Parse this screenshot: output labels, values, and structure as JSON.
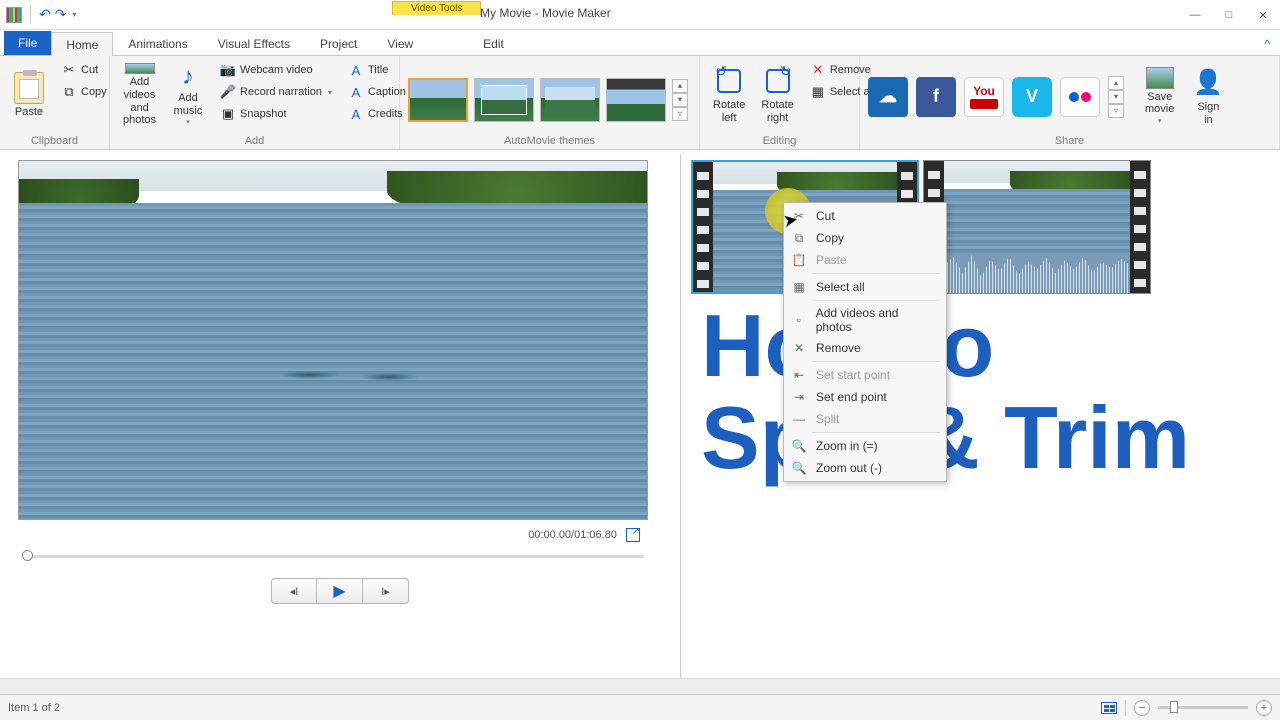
{
  "qat": {
    "undo": "↶",
    "redo": "↷"
  },
  "video_tools_label": "Video Tools",
  "window_title": "My Movie - Movie Maker",
  "tabs": {
    "file": "File",
    "home": "Home",
    "animations": "Animations",
    "visual_effects": "Visual Effects",
    "project": "Project",
    "view": "View",
    "edit": "Edit"
  },
  "ribbon": {
    "clipboard": {
      "label": "Clipboard",
      "paste": "Paste",
      "cut": "Cut",
      "copy": "Copy"
    },
    "add": {
      "label": "Add",
      "add_videos": "Add videos\nand photos",
      "add_music": "Add\nmusic",
      "webcam": "Webcam video",
      "narration": "Record narration",
      "snapshot": "Snapshot",
      "title": "Title",
      "caption": "Caption",
      "credits": "Credits"
    },
    "themes": {
      "label": "AutoMovie themes"
    },
    "editing": {
      "label": "Editing",
      "rotate_left": "Rotate\nleft",
      "rotate_right": "Rotate\nright",
      "remove": "Remove",
      "select_all": "Select all"
    },
    "share": {
      "label": "Share",
      "save_movie": "Save\nmovie",
      "sign_in": "Sign\nin"
    }
  },
  "preview": {
    "time": "00:00.00/01:06.80"
  },
  "context_menu": {
    "cut": "Cut",
    "copy": "Copy",
    "paste": "Paste",
    "select_all": "Select all",
    "add": "Add videos and photos",
    "remove": "Remove",
    "set_start": "Set start point",
    "set_end": "Set end point",
    "split": "Split",
    "zoom_in": "Zoom in (=)",
    "zoom_out": "Zoom out (-)"
  },
  "overlay": {
    "line1": "How to",
    "line2": "Split & Trim"
  },
  "status": {
    "item": "Item 1 of 2"
  }
}
